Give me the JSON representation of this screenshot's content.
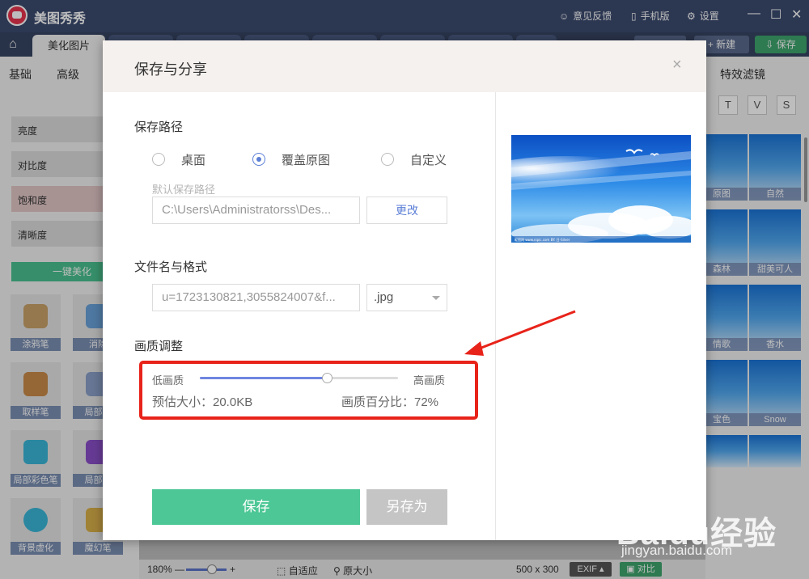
{
  "app": {
    "title": "美图秀秀",
    "links": [
      "意见反馈",
      "手机版",
      "设置"
    ]
  },
  "tabs": {
    "active": "美化图片",
    "new_label": "新建",
    "save_label": "保存"
  },
  "left_panel": {
    "tabs": [
      "基础",
      "高级"
    ],
    "adjustments": [
      "亮度",
      "对比度",
      "饱和度",
      "清晰度"
    ],
    "one_key_label": "一键美化",
    "tools": [
      "涂鸦笔",
      "消除",
      "取样笔",
      "局部马",
      "局部彩色笔",
      "局部变",
      "背景虚化",
      "魔幻笔"
    ]
  },
  "right_panel": {
    "title": "特效滤镜",
    "categories": [
      "T",
      "V",
      "S"
    ],
    "filters": [
      "原图",
      "自然",
      "森林",
      "甜美可人",
      "情歌",
      "香水",
      "宝色",
      "Snow",
      "",
      ""
    ]
  },
  "bottom_bar": {
    "zoom": "180%",
    "fit_label": "自适应",
    "original_label": "原大小",
    "dimensions": "500 x 300",
    "exif_label": "EXIF",
    "compare_label": "对比"
  },
  "dialog": {
    "title": "保存与分享",
    "close_glyph": "×",
    "save_path": {
      "label": "保存路径",
      "options": [
        "桌面",
        "覆盖原图",
        "自定义"
      ],
      "selected": "覆盖原图",
      "hint": "默认保存路径",
      "path_value": "C:\\Users\\Administratorss\\Des...",
      "change_label": "更改"
    },
    "file": {
      "label": "文件名与格式",
      "filename": "u=1723130821,3055824007&f...",
      "format": ".jpg"
    },
    "quality": {
      "label": "画质调整",
      "low_label": "低画质",
      "high_label": "高画质",
      "level": 0.64,
      "size_text": "预估大小：20.0KB",
      "percent_text": "画质百分比：72%"
    },
    "save_label": "保存",
    "save_as_label": "另存为"
  },
  "preview": {
    "caption": "昵图网 www.nipic.com  BY: 日-Silver"
  },
  "colors": {
    "annotation": "#e8231a",
    "primary_green": "#4cc795",
    "accent_blue": "#6f86e0",
    "titlebar": "#3c4b6f"
  },
  "watermark": {
    "brand": "Baidu经验",
    "url": "jingyan.baidu.com"
  }
}
